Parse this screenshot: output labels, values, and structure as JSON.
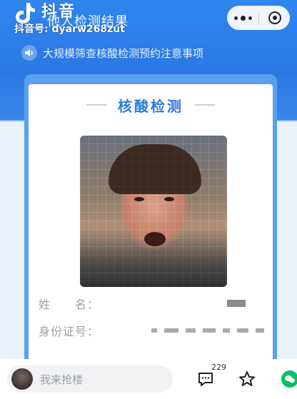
{
  "watermark": {
    "app_name": "抖音",
    "user_id": "抖音号: dyarw268zut"
  },
  "header": {
    "title": "他人检测结果"
  },
  "notice": {
    "text": "大规模筛查核酸检测预约注意事项"
  },
  "card": {
    "title": "核酸检测",
    "fields": [
      {
        "label": "姓　　名："
      },
      {
        "label": "身份证号："
      }
    ]
  },
  "bottom": {
    "comment_placeholder": "我来抢楼",
    "comment_count": "229"
  },
  "colors": {
    "primary_blue": "#2c7ae0",
    "header_blue": "#2f86ef",
    "wechat_green": "#07c160"
  },
  "icons": [
    "tiktok-logo-icon",
    "more-icon",
    "close-miniprogram-icon",
    "speaker-icon",
    "comment-icon",
    "star-icon",
    "wechat-icon"
  ]
}
